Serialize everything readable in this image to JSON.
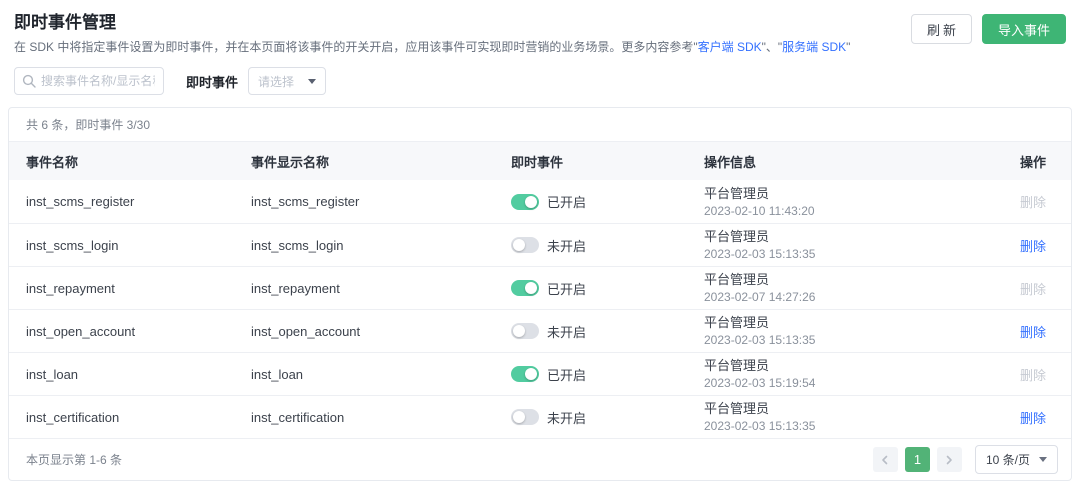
{
  "header": {
    "title": "即时事件管理",
    "description": {
      "prefix": "在 SDK 中将指定事件设置为即时事件，并在本页面将该事件的开关开启，应用该事件可实现即时营销的业务场景。更多内容参考\"",
      "link_client": "客户端 SDK",
      "separator": "\"、\"",
      "link_server": "服务端 SDK",
      "suffix": "\""
    },
    "refresh_button": "刷新",
    "import_button": "导入事件"
  },
  "filter": {
    "search_placeholder": "搜索事件名称/显示名称",
    "label": "即时事件",
    "select_placeholder": "请选择"
  },
  "table": {
    "summary": "共 6 条，即时事件 3/30",
    "columns": {
      "name": "事件名称",
      "display_name": "事件显示名称",
      "instant": "即时事件",
      "operation_info": "操作信息",
      "actions": "操作"
    },
    "delete_label": "删除",
    "rows": [
      {
        "name": "inst_scms_register",
        "display": "inst_scms_register",
        "on": true,
        "state": "已开启",
        "operator": "平台管理员",
        "time": "2023-02-10 11:43:20",
        "delete_enabled": false
      },
      {
        "name": "inst_scms_login",
        "display": "inst_scms_login",
        "on": false,
        "state": "未开启",
        "operator": "平台管理员",
        "time": "2023-02-03 15:13:35",
        "delete_enabled": true
      },
      {
        "name": "inst_repayment",
        "display": "inst_repayment",
        "on": true,
        "state": "已开启",
        "operator": "平台管理员",
        "time": "2023-02-07 14:27:26",
        "delete_enabled": false
      },
      {
        "name": "inst_open_account",
        "display": "inst_open_account",
        "on": false,
        "state": "未开启",
        "operator": "平台管理员",
        "time": "2023-02-03 15:13:35",
        "delete_enabled": true
      },
      {
        "name": "inst_loan",
        "display": "inst_loan",
        "on": true,
        "state": "已开启",
        "operator": "平台管理员",
        "time": "2023-02-03 15:19:54",
        "delete_enabled": false
      },
      {
        "name": "inst_certification",
        "display": "inst_certification",
        "on": false,
        "state": "未开启",
        "operator": "平台管理员",
        "time": "2023-02-03 15:13:35",
        "delete_enabled": true
      }
    ],
    "footer": {
      "range_text": "本页显示第 1-6 条",
      "current_page": "1",
      "page_size": "10 条/页"
    }
  },
  "colors": {
    "accent_green": "#3eb575",
    "toggle_on_green": "#52cca0",
    "pagination_green": "#52b377",
    "link_blue": "#3370ff"
  }
}
